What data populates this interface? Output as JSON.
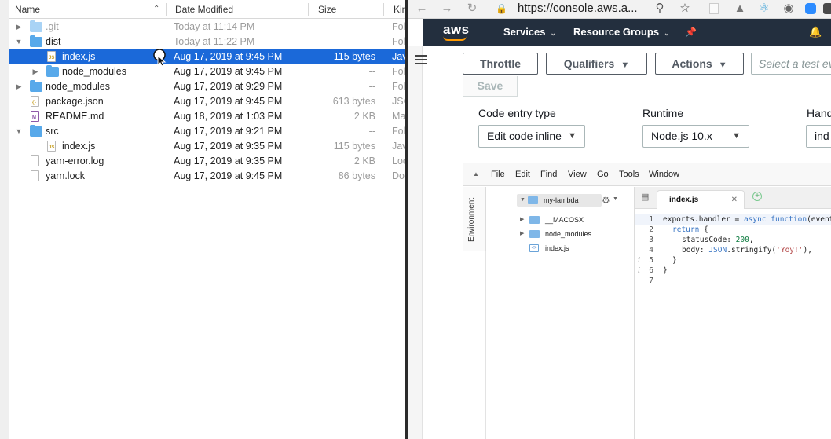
{
  "finder": {
    "columns": {
      "name": "Name",
      "date": "Date Modified",
      "size": "Size",
      "kind": "Kin"
    },
    "rows": [
      {
        "name": "git",
        "date": "Today at 11:14 PM",
        "size": "--",
        "kind": "Fol"
      },
      {
        "name": "dist",
        "date": "Today at 11:22 PM",
        "size": "--",
        "kind": "Fol"
      },
      {
        "name": "index.js",
        "date": "Aug 17, 2019 at 9:45 PM",
        "size": "115 bytes",
        "kind": "Jav"
      },
      {
        "name": "node_modules",
        "date": "Aug 17, 2019 at 9:45 PM",
        "size": "--",
        "kind": "Fol"
      },
      {
        "name": "node_modules",
        "date": "Aug 17, 2019 at 9:29 PM",
        "size": "--",
        "kind": "Fol"
      },
      {
        "name": "package.json",
        "date": "Aug 17, 2019 at 9:45 PM",
        "size": "613 bytes",
        "kind": "JSC"
      },
      {
        "name": "README.md",
        "date": "Aug 18, 2019 at 1:03 PM",
        "size": "2 KB",
        "kind": "Ma"
      },
      {
        "name": "src",
        "date": "Aug 17, 2019 at 9:21 PM",
        "size": "--",
        "kind": "Fol"
      },
      {
        "name": "index.js",
        "date": "Aug 17, 2019 at 9:35 PM",
        "size": "115 bytes",
        "kind": "Jav"
      },
      {
        "name": "yarn-error.log",
        "date": "Aug 17, 2019 at 9:35 PM",
        "size": "2 KB",
        "kind": "Loc"
      },
      {
        "name": "yarn.lock",
        "date": "Aug 17, 2019 at 9:45 PM",
        "size": "86 bytes",
        "kind": "Do"
      }
    ]
  },
  "browser": {
    "url": "https://console.aws.a..."
  },
  "aws_nav": {
    "logo": "aws",
    "services": "Services",
    "resource_groups": "Resource Groups"
  },
  "lambda": {
    "throttle": "Throttle",
    "qualifiers": "Qualifiers",
    "actions": "Actions",
    "test_placeholder": "Select a test ev",
    "save": "Save",
    "code_entry_label": "Code entry type",
    "code_entry_value": "Edit code inline",
    "runtime_label": "Runtime",
    "runtime_value": "Node.js 10.x",
    "handler_label": "Hand",
    "handler_value": "ind"
  },
  "editor": {
    "menu": [
      "File",
      "Edit",
      "Find",
      "View",
      "Go",
      "Tools",
      "Window"
    ],
    "environment_tab": "Environment",
    "tree": {
      "root": "my-lambda",
      "items": [
        "__MACOSX",
        "node_modules",
        "index.js"
      ]
    },
    "active_tab": "index.js",
    "line_numbers": [
      "1",
      "2",
      "3",
      "4",
      "5",
      "6",
      "7"
    ],
    "code": {
      "l1_a": "exports.handler = ",
      "l1_kw1": "async",
      "l1_sp": " ",
      "l1_kw2": "function",
      "l1_b": "(event",
      "l2_kw": "return",
      "l2_b": " {",
      "l3_a": "statusCode: ",
      "l3_num": "200",
      "l3_b": ",",
      "l4_a": "body: ",
      "l4_obj": "JSON",
      "l4_b": ".stringify(",
      "l4_str": "'Yoy!'",
      "l4_c": "),",
      "l5": "}",
      "l6": "}"
    }
  }
}
